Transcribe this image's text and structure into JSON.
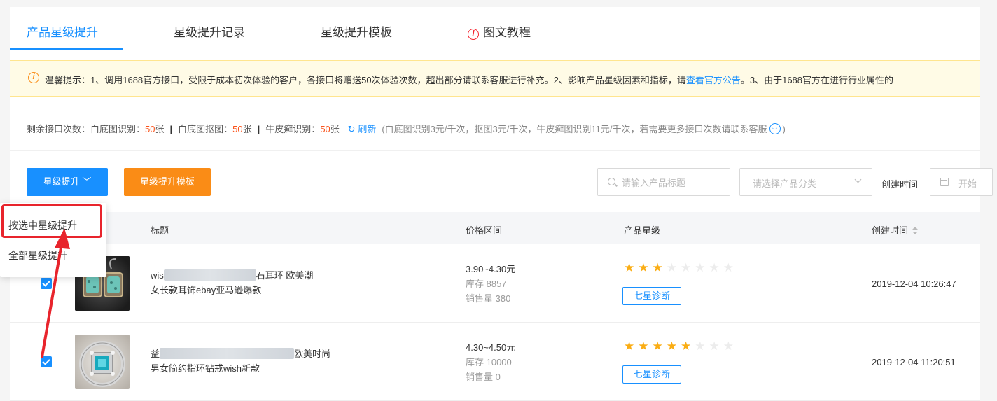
{
  "tabs": [
    {
      "label": "产品星级提升",
      "active": true
    },
    {
      "label": "星级提升记录",
      "active": false
    },
    {
      "label": "星级提升模板",
      "active": false
    },
    {
      "label": "图文教程",
      "active": false,
      "icon": "info-italic-icon"
    }
  ],
  "notice": {
    "icon": "info-italic-icon",
    "text_before": "温馨提示：1、调用1688官方接口，受限于成本初次体验的客户，各接口将赠送50次体验次数，超出部分请联系客服进行补充。2、影响产品星级因素和指标，请",
    "link": "查看官方公告",
    "text_after": "。3、由于1688官方在进行行业属性的"
  },
  "quota": {
    "label": "剩余接口次数：",
    "items": [
      {
        "name": "白底图识别：",
        "value": "50",
        "unit": "张"
      },
      {
        "name": "白底图抠图：",
        "value": "50",
        "unit": "张"
      },
      {
        "name": "牛皮癣识别：",
        "value": "50",
        "unit": "张"
      }
    ],
    "separator": "|",
    "refresh": "刷新",
    "note": "(白底图识别3元/千次，抠图3元/千次，牛皮癣图识别11元/千次，若需要更多接口次数请联系客服",
    "note_end": ")"
  },
  "toolbar": {
    "star_up_label": "星级提升",
    "template_label": "星级提升模板",
    "search_placeholder": "请输入产品标题",
    "category_placeholder": "请选择产品分类",
    "create_time_label": "创建时间",
    "date_placeholder": "开始"
  },
  "dropdown": {
    "items": [
      "按选中星级提升",
      "全部星级提升"
    ]
  },
  "table": {
    "headers": {
      "title": "标题",
      "price": "价格区间",
      "stars": "产品星级",
      "ctime": "创建时间"
    },
    "rows": [
      {
        "title_prefix": "wis",
        "title_suffix": "石耳环 欧美潮",
        "title_line2": "女长款耳饰ebay亚马逊爆款",
        "price": "3.90~4.30元",
        "stock": "库存 8857",
        "sales": "销售量 380",
        "stars_filled": 3,
        "stars_total": 8,
        "diag_label": "七星诊断",
        "ctime": "2019-12-04 10:26:47",
        "checked": true
      },
      {
        "title_prefix": "益",
        "title_suffix": "欧美时尚",
        "title_line2": "男女简约指环钻戒wish新款",
        "price": "4.30~4.50元",
        "stock": "库存 10000",
        "sales": "销售量 0",
        "stars_filled": 5,
        "stars_total": 8,
        "diag_label": "七星诊断",
        "ctime": "2019-12-04 11:20:51",
        "checked": true
      }
    ]
  },
  "colors": {
    "primary": "#1890ff",
    "orange": "#fa8c16",
    "star": "#faad14",
    "annotation_red": "#e8242c"
  }
}
